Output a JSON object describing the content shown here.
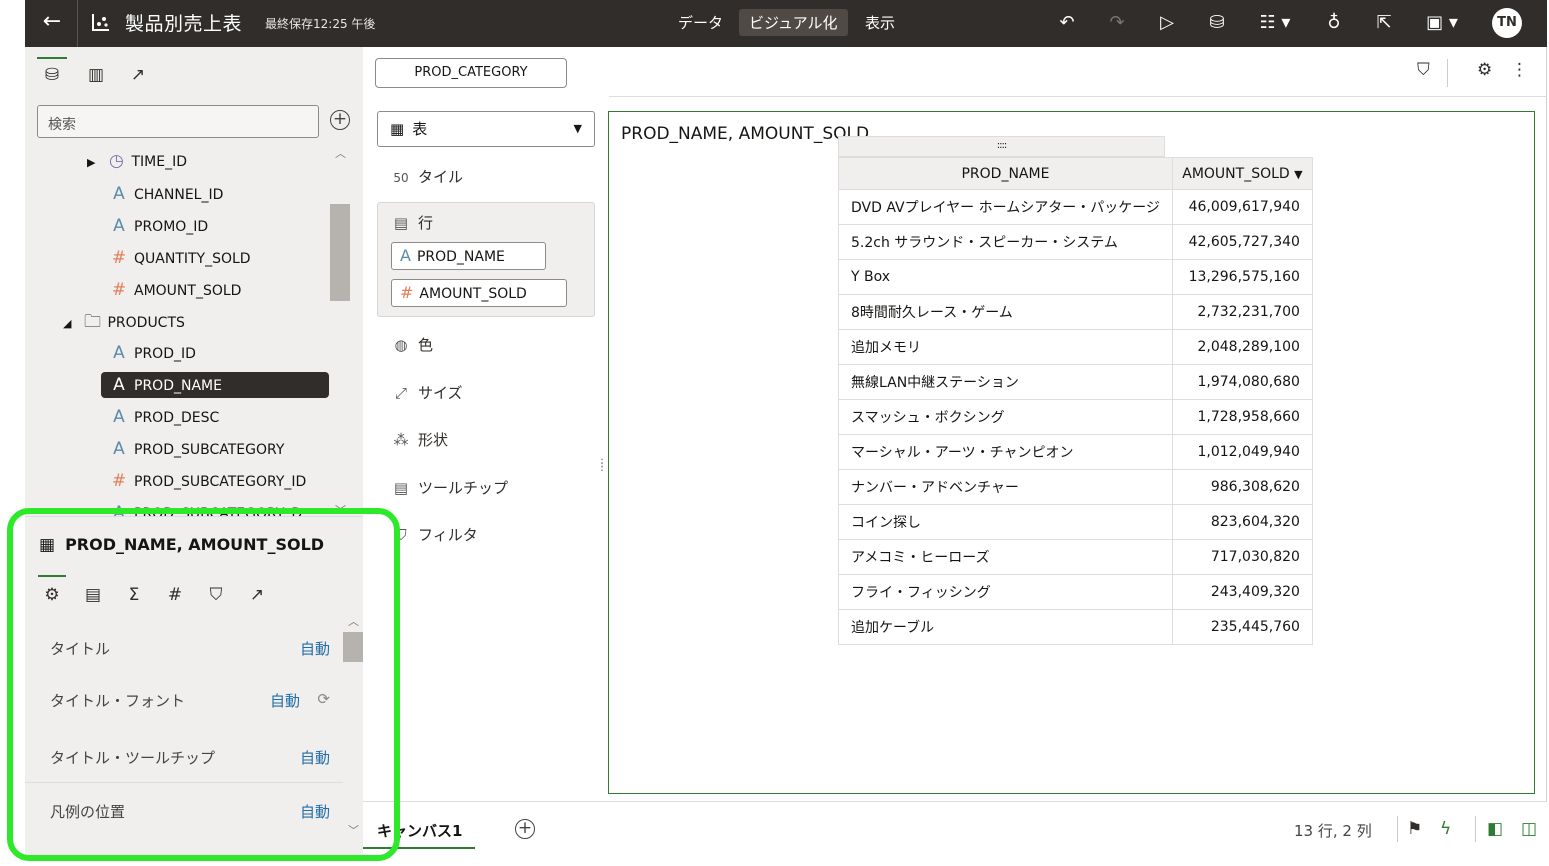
{
  "topbar": {
    "title": "製品別売上表",
    "saved": "最終保存12:25 午後",
    "nav": [
      "データ",
      "ビジュアル化",
      "表示"
    ],
    "active_nav": "ビジュアル化",
    "avatar": "TN"
  },
  "data_panel": {
    "search_placeholder": "検索",
    "items": [
      {
        "label": "TIME_ID",
        "type": "time"
      },
      {
        "label": "CHANNEL_ID",
        "type": "attr"
      },
      {
        "label": "PROMO_ID",
        "type": "attr"
      },
      {
        "label": "QUANTITY_SOLD",
        "type": "measure"
      },
      {
        "label": "AMOUNT_SOLD",
        "type": "measure"
      },
      {
        "label": "PRODUCTS",
        "type": "folder"
      },
      {
        "label": "PROD_ID",
        "type": "attr"
      },
      {
        "label": "PROD_NAME",
        "type": "attr",
        "selected": true
      },
      {
        "label": "PROD_DESC",
        "type": "attr"
      },
      {
        "label": "PROD_SUBCATEGORY",
        "type": "attr"
      },
      {
        "label": "PROD_SUBCATEGORY_ID",
        "type": "measure"
      },
      {
        "label": "PROD_SUBCATEGORY_D",
        "type": "attr"
      }
    ]
  },
  "properties": {
    "title": "PROD_NAME, AMOUNT_SOLD",
    "rows": [
      {
        "label": "タイトル",
        "value": "自動"
      },
      {
        "label": "タイトル・フォント",
        "value": "自動"
      },
      {
        "label": "タイトル・ツールチップ",
        "value": "自動"
      },
      {
        "label": "凡例の位置",
        "value": "自動"
      }
    ]
  },
  "grammar": {
    "filter_chip": "PROD_CATEGORY",
    "viz_type": "表",
    "tile": "タイル",
    "rows_label": "行",
    "rows_pills": [
      "PROD_NAME",
      "AMOUNT_SOLD"
    ],
    "color": "色",
    "size": "サイズ",
    "shape": "形状",
    "tooltip": "ツールチップ",
    "filter": "フィルタ"
  },
  "viz": {
    "title": "PROD_NAME, AMOUNT_SOLD",
    "columns": [
      "PROD_NAME",
      "AMOUNT_SOLD"
    ],
    "rows": [
      [
        "DVD AVプレイヤー ホームシアター・パッケージ",
        "46,009,617,940"
      ],
      [
        "5.2ch サラウンド・スピーカー・システム",
        "42,605,727,340"
      ],
      [
        "Y Box",
        "13,296,575,160"
      ],
      [
        "8時間耐久レース・ゲーム",
        "2,732,231,700"
      ],
      [
        "追加メモリ",
        "2,048,289,100"
      ],
      [
        "無線LAN中継ステーション",
        "1,974,080,680"
      ],
      [
        "スマッシュ・ボクシング",
        "1,728,958,660"
      ],
      [
        "マーシャル・アーツ・チャンピオン",
        "1,012,049,940"
      ],
      [
        "ナンバー・アドベンチャー",
        "986,308,620"
      ],
      [
        "コイン探し",
        "823,604,320"
      ],
      [
        "アメコミ・ヒーローズ",
        "717,030,820"
      ],
      [
        "フライ・フィッシング",
        "243,409,320"
      ],
      [
        "追加ケーブル",
        "235,445,760"
      ]
    ]
  },
  "bottom": {
    "canvas_tab": "キャンバス1",
    "status": "13 行, 2 列"
  },
  "colors": {
    "topbar": "#312d2a",
    "accent": "#2f7d32",
    "highlight": "#2ee82a",
    "link": "#216ea8"
  }
}
